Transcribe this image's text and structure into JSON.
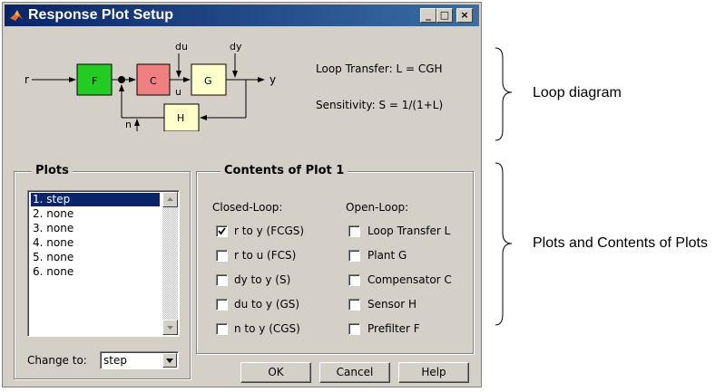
{
  "window": {
    "title": "Response Plot Setup",
    "minimize_glyph": "_",
    "maximize_glyph": "□",
    "close_glyph": "×"
  },
  "diagram": {
    "block_f": "F",
    "block_c": "C",
    "block_g": "G",
    "block_h": "H",
    "sig_r": "r",
    "sig_y": "y",
    "sig_du": "du",
    "sig_u": "u",
    "sig_dy": "dy",
    "sig_n": "n",
    "colors": {
      "f": "#22cc22",
      "c": "#f08080",
      "g": "#ffffcc",
      "h": "#ffffcc"
    }
  },
  "equations": {
    "loop": "Loop Transfer: L = CGH",
    "sensitivity": "Sensitivity:  S = 1/(1+L)"
  },
  "plots": {
    "group_label": "Plots",
    "items": [
      "1. step",
      "2. none",
      "3. none",
      "4. none",
      "5. none",
      "6. none"
    ],
    "selected_index": 0,
    "change_to_label": "Change to:",
    "change_to_value": "step"
  },
  "contents": {
    "group_label": "Contents of Plot 1",
    "closed_header": "Closed-Loop:",
    "open_header": "Open-Loop:",
    "closed": [
      {
        "label": "r to y  (FCGS)",
        "checked": true
      },
      {
        "label": "r to u  (FCS)",
        "checked": false
      },
      {
        "label": "dy to y  (S)",
        "checked": false
      },
      {
        "label": "du to y  (GS)",
        "checked": false
      },
      {
        "label": "n to y  (CGS)",
        "checked": false
      }
    ],
    "open": [
      {
        "label": "Loop Transfer L",
        "checked": false
      },
      {
        "label": "Plant G",
        "checked": false
      },
      {
        "label": "Compensator C",
        "checked": false
      },
      {
        "label": "Sensor H",
        "checked": false
      },
      {
        "label": "Prefilter F",
        "checked": false
      }
    ]
  },
  "buttons": {
    "ok": "OK",
    "cancel": "Cancel",
    "help": "Help"
  },
  "annotations": {
    "loop_diagram": "Loop diagram",
    "plots_contents": "Plots and Contents of Plots"
  }
}
